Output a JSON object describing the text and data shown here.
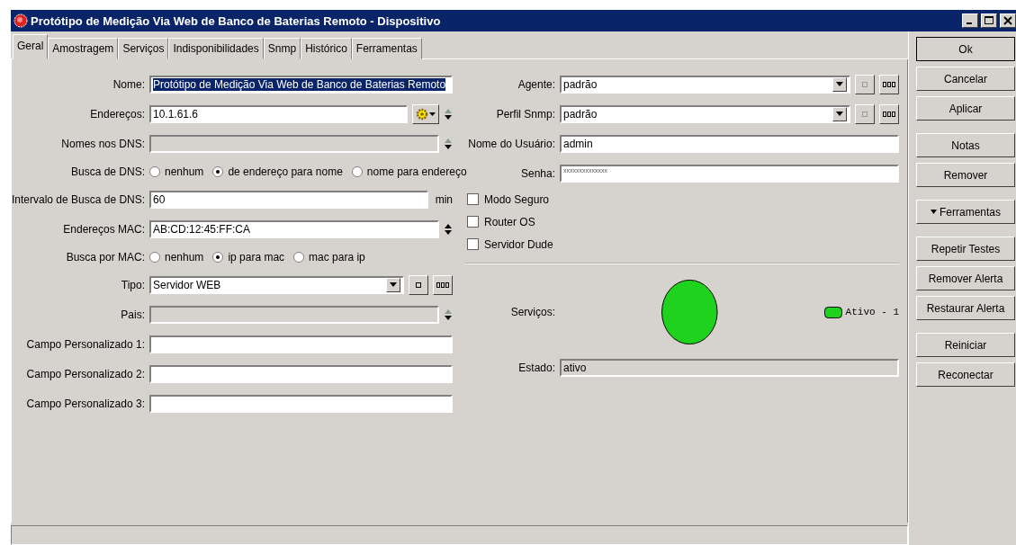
{
  "window": {
    "title": "Protótipo de Medição Via Web de Banco de Baterias Remoto - Dispositivo"
  },
  "tabs": [
    {
      "label": "Geral",
      "selected": true
    },
    {
      "label": "Amostragem",
      "selected": false
    },
    {
      "label": "Serviços",
      "selected": false
    },
    {
      "label": "Indisponibilidades",
      "selected": false
    },
    {
      "label": "Snmp",
      "selected": false
    },
    {
      "label": "Histórico",
      "selected": false
    },
    {
      "label": "Ferramentas",
      "selected": false
    }
  ],
  "left_form": [
    {
      "kind": "field",
      "label": "Nome:",
      "value": "Protótipo de Medição Via Web de Banco de Baterias Remoto",
      "disabled": false,
      "value_selected": true
    },
    {
      "kind": "field",
      "label": "Endereços:",
      "value": "10.1.61.6",
      "disabled": false,
      "value_selected": false,
      "menu_button": true,
      "spinner": {
        "up_enabled": false,
        "down_enabled": true
      }
    },
    {
      "kind": "field",
      "label": "Nomes nos DNS:",
      "disabled": true,
      "spinner": {
        "up_enabled": false,
        "down_enabled": true
      }
    },
    {
      "kind": "radio",
      "label": "Busca de DNS:",
      "options": [
        {
          "label": "nenhum",
          "selected": false
        },
        {
          "label": "de endereço para nome",
          "selected": true
        },
        {
          "label": "nome para endereço",
          "selected": false
        }
      ]
    },
    {
      "kind": "field",
      "label": "Intervalo de Busca de DNS:",
      "value": "60",
      "disabled": false,
      "value_selected": false,
      "unit": "min"
    },
    {
      "kind": "field",
      "label": "Endereços MAC:",
      "value": "AB:CD:12:45:FF:CA",
      "disabled": false,
      "value_selected": false,
      "spinner": {
        "up_enabled": true,
        "down_enabled": true
      }
    },
    {
      "kind": "radio",
      "label": "Busca por MAC:",
      "options": [
        {
          "label": "nenhum",
          "selected": false
        },
        {
          "label": "ip para mac",
          "selected": true
        },
        {
          "label": "mac para ip",
          "selected": false
        }
      ]
    },
    {
      "kind": "combo",
      "label": "Tipo:",
      "value": "Servidor WEB",
      "clear_disabled": false
    },
    {
      "kind": "field",
      "label": "Pais:",
      "disabled": true,
      "spinner": {
        "up_enabled": false,
        "down_enabled": true
      }
    },
    {
      "kind": "field",
      "label": "Campo Personalizado 1:",
      "disabled": false
    },
    {
      "kind": "field",
      "label": "Campo Personalizado 2:",
      "disabled": false
    },
    {
      "kind": "field",
      "label": "Campo Personalizado 3:",
      "disabled": false
    }
  ],
  "right_form": [
    {
      "kind": "combo",
      "label": "Agente:",
      "value": "padrão",
      "clear_disabled": true
    },
    {
      "kind": "combo",
      "label": "Perfil Snmp:",
      "value": "padrão",
      "clear_disabled": true
    },
    {
      "kind": "field",
      "label": "Nome do Usuário:",
      "value": "admin",
      "disabled": false,
      "value_selected": false
    },
    {
      "kind": "password",
      "label": "Senha:",
      "value": "xxxxxxxxxxxxxx"
    },
    {
      "kind": "checkbox",
      "label": "Modo Seguro",
      "checked": false
    },
    {
      "kind": "checkbox",
      "label": "Router OS",
      "checked": false
    },
    {
      "kind": "checkbox",
      "label": "Servidor Dude",
      "checked": false
    },
    {
      "kind": "divider"
    },
    {
      "kind": "services",
      "label": "Serviços:",
      "legend": [
        {
          "label": "Ativo - 1",
          "color": "#1ed21e"
        }
      ]
    },
    {
      "kind": "field",
      "label": "Estado:",
      "value": "ativo",
      "disabled": true,
      "value_selected": false
    }
  ],
  "side_buttons": [
    [
      {
        "label": "Ok",
        "kind": "plain",
        "default": true
      },
      {
        "label": "Cancelar",
        "kind": "plain",
        "default": false
      },
      {
        "label": "Aplicar",
        "kind": "plain",
        "default": false
      }
    ],
    [
      {
        "label": "Notas",
        "kind": "plain",
        "default": false
      },
      {
        "label": "Remover",
        "kind": "plain",
        "default": false
      }
    ],
    [
      {
        "label": "Ferramentas",
        "kind": "menu",
        "default": false
      }
    ],
    [
      {
        "label": "Repetir Testes",
        "kind": "plain",
        "default": false
      },
      {
        "label": "Remover Alerta",
        "kind": "plain",
        "default": false
      },
      {
        "label": "Restaurar Alerta",
        "kind": "plain",
        "default": false
      }
    ],
    [
      {
        "label": "Reiniciar",
        "kind": "plain",
        "default": false
      },
      {
        "label": "Reconectar",
        "kind": "plain",
        "default": false
      }
    ]
  ]
}
